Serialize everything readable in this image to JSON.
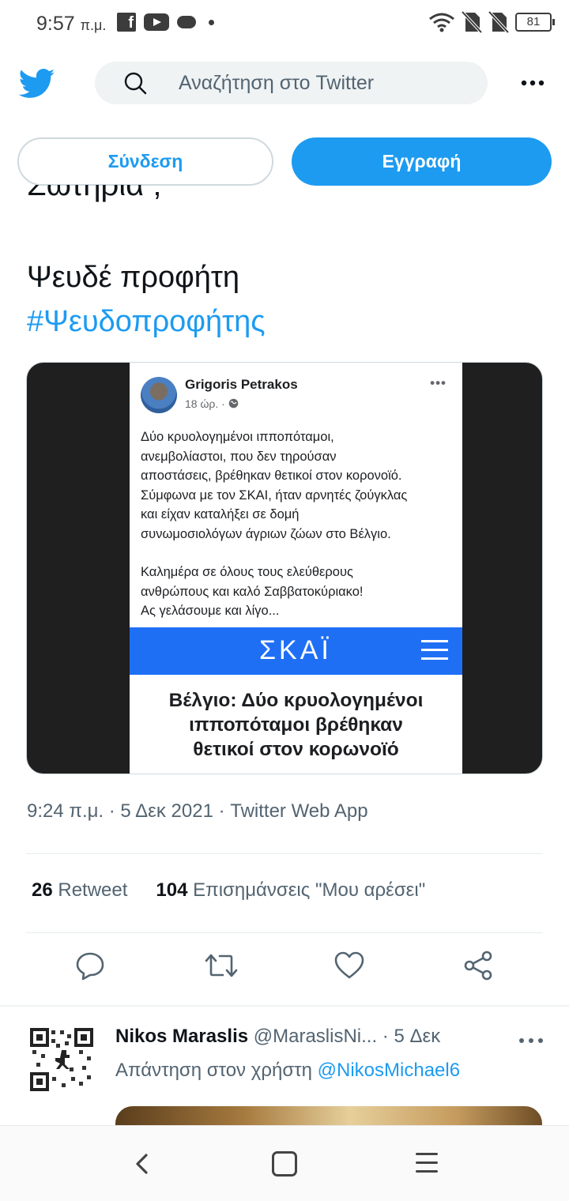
{
  "status_bar": {
    "time": "9:57",
    "time_suffix": "π.μ.",
    "battery": "81",
    "icons": [
      "facebook-icon",
      "youtube-icon",
      "cloud-icon",
      "dot-icon",
      "wifi-icon",
      "no-sim-icon",
      "no-sim-icon",
      "battery-icon"
    ]
  },
  "header": {
    "search_placeholder": "Αναζήτηση στο Twitter",
    "icons": [
      "twitter-logo-icon",
      "search-icon",
      "more-icon"
    ]
  },
  "auth": {
    "login_label": "Σύνδεση",
    "signup_label": "Εγγραφή"
  },
  "tweet": {
    "cutoff_text": "Σωτηρία ;",
    "text_line1": "Ψευδέ προφήτη",
    "hashtag": "#Ψευδοπροφήτης",
    "media": {
      "fb_name": "Grigoris Petrakos",
      "fb_time": "18 ώρ. ·",
      "fb_text": [
        "Δύο κρυολογημένοι ιπποπόταμοι,",
        "ανεμβολίαστοι, που δεν τηρούσαν",
        "αποστάσεις, βρέθηκαν θετικοί στον κορονοϊό.",
        "Σύμφωνα με τον ΣΚΑΙ, ήταν αρνητές ζούγκλας",
        "και είχαν καταλήξει σε δομή",
        "συνωμοσιολόγων άγριων ζώων στο Βέλγιο.",
        "",
        "Καλημέρα σε όλους τους ελεύθερους",
        "ανθρώπους και καλό Σαββατοκύριακο!",
        "Ας γελάσουμε και λίγο..."
      ],
      "skai_logo": "ΣΚΑΪ",
      "headline": [
        "Βέλγιο: Δύο κρυολογημένοι",
        "ιπποπόταμοι βρέθηκαν",
        "θετικοί στον κορωνοϊό"
      ]
    },
    "timestamp": "9:24 π.μ. · 5 Δεκ 2021 · Twitter Web App",
    "retweets_count": "26",
    "retweets_label": "Retweet",
    "likes_count": "104",
    "likes_label": "Επισημάνσεις \"Μου αρέσει\"",
    "action_icons": [
      "reply-icon",
      "retweet-icon",
      "like-icon",
      "share-icon"
    ]
  },
  "reply": {
    "name": "Nikos Maraslis",
    "handle_and_date": "@MaraslisNi... · 5 Δεκ",
    "replying_prefix": "Απάντηση στον χρήστη",
    "replying_to": "@NikosMichael6"
  },
  "colors": {
    "accent": "#1d9bf0",
    "skai_blue": "#1f6ff5",
    "text_primary": "#0f1419",
    "text_secondary": "#536471"
  }
}
